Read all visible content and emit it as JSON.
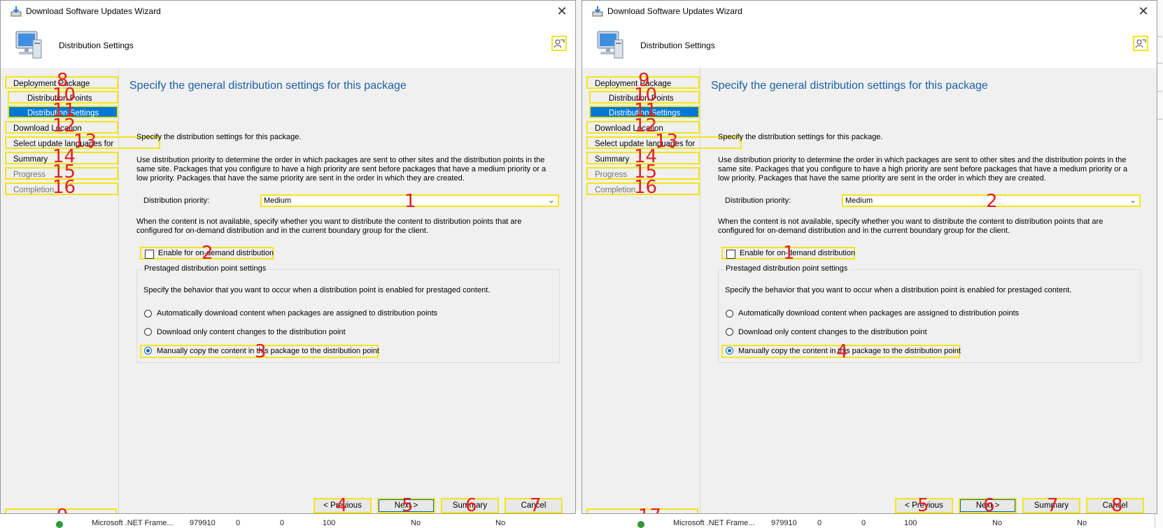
{
  "windows": [
    {
      "title": "Download Software Updates Wizard",
      "close_glyph": "✕",
      "banner_title": "Distribution Settings",
      "nav": [
        {
          "label": "Deployment Package",
          "num": "8"
        },
        {
          "label": "Distribution Points",
          "num": "10"
        },
        {
          "label": "Distribution Settings",
          "num": "11"
        },
        {
          "label": "Download Location",
          "num": "12"
        },
        {
          "label": "Select update languages for",
          "num": "13"
        },
        {
          "label": "Summary",
          "num": "14"
        },
        {
          "label": "Progress",
          "num": "15"
        },
        {
          "label": "Completion",
          "num": "16"
        }
      ],
      "progress_num": "9",
      "heading": "Specify the general distribution settings for this package",
      "intro": "Specify the distribution settings for this package.",
      "priority_desc": "Use distribution priority to determine the order in which packages are sent to other sites and the distribution points in the same site. Packages that you configure to have a high priority are sent before packages that have a medium priority or a low priority. Packages that have the same priority are sent in the order in which they are created.",
      "priority_label": "Distribution priority:",
      "priority_value": "Medium",
      "priority_num": "1",
      "ondemand_desc": "When the content is not available, specify whether you want to distribute the content to distribution points that are configured for on-demand distribution and in the current boundary group for the client.",
      "ondemand_label": "Enable for on-demand distribution",
      "ondemand_num": "2",
      "prestaged_title": "Prestaged distribution point settings",
      "prestaged_desc": "Specify the behavior that you want to occur when a distribution point is enabled for prestaged content.",
      "radio1": "Automatically download content when packages are assigned to distribution points",
      "radio2": "Download only content changes to the distribution point",
      "radio3": "Manually copy the content in this package to the distribution point",
      "radio3_num": "3",
      "buttons": {
        "previous": "< Previous",
        "previous_num": "4",
        "next": "Next >",
        "next_num": "5",
        "summary": "Summary",
        "summary_num": "6",
        "cancel": "Cancel",
        "cancel_num": "7"
      }
    },
    {
      "title": "Download Software Updates Wizard",
      "close_glyph": "✕",
      "banner_title": "Distribution Settings",
      "nav": [
        {
          "label": "Deployment Package",
          "num": "9"
        },
        {
          "label": "Distribution Points",
          "num": "10"
        },
        {
          "label": "Distribution Settings",
          "num": "11"
        },
        {
          "label": "Download Location",
          "num": "12"
        },
        {
          "label": "Select update languages for",
          "num": "13"
        },
        {
          "label": "Summary",
          "num": "14"
        },
        {
          "label": "Progress",
          "num": "15"
        },
        {
          "label": "Completion",
          "num": "16"
        }
      ],
      "progress_num": "17",
      "heading": "Specify the general distribution settings for this package",
      "intro": "Specify the distribution settings for this package.",
      "priority_desc": "Use distribution priority to determine the order in which packages are sent to other sites and the distribution points in the same site. Packages that you configure to have a high priority are sent before packages that have a medium priority or a low priority. Packages that have the same priority are sent in the order in which they are created.",
      "priority_label": "Distribution priority:",
      "priority_value": "Medium",
      "priority_num": "2",
      "ondemand_desc": "When the content is not available, specify whether you want to distribute the content to distribution points that are configured for on-demand distribution and in the current boundary group for the client.",
      "ondemand_label": "Enable for on-demand distribution",
      "ondemand_num": "1",
      "prestaged_title": "Prestaged distribution point settings",
      "prestaged_desc": "Specify the behavior that you want to occur when a distribution point is enabled for prestaged content.",
      "radio1": "Automatically download content when packages are assigned to distribution points",
      "radio2": "Download only content changes to the distribution point",
      "radio3": "Manually copy the content in this package to the distribution point",
      "radio3_num": "4",
      "buttons": {
        "previous": "< Previous",
        "previous_num": "5",
        "next": "Next >",
        "next_num": "6",
        "summary": "Summary",
        "summary_num": "7",
        "cancel": "Cancel",
        "cancel_num": "8"
      }
    }
  ],
  "background_rows": [
    {
      "name": "Microsoft .NET Frame...",
      "id": "979910",
      "c1": "0",
      "c2": "0",
      "c3": "100",
      "c4": "No",
      "c5": "No"
    },
    {
      "name": "Microsoft .NET Frame...",
      "id": "979910",
      "c1": "0",
      "c2": "0",
      "c3": "100",
      "c4": "No",
      "c5": "No"
    }
  ],
  "colors": {
    "highlight": "#f2e51a",
    "accent": "#0078d7",
    "annotation": "#e02020",
    "heading": "#1a5fa8"
  }
}
